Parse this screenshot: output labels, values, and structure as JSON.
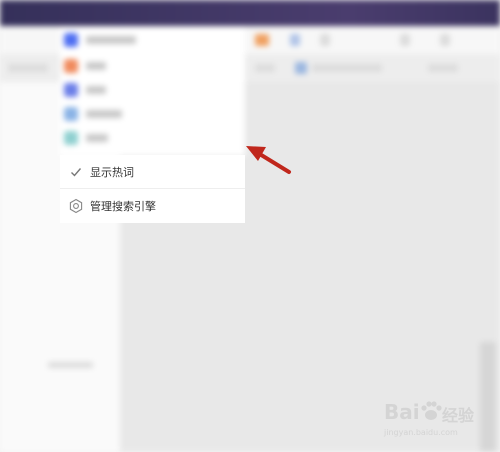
{
  "menu": {
    "show_hot_label": "显示热词",
    "manage_engines_label": "管理搜索引擎"
  },
  "icons": {
    "checkmark": "checkmark-icon",
    "settings": "gear-icon"
  },
  "watermark": {
    "brand": "Bai",
    "brand2": "du",
    "suffix": "经验",
    "url": "jingyan.baidu.com"
  },
  "colors": {
    "arrow": "#c0271c",
    "titlebar": "#3b335f"
  }
}
